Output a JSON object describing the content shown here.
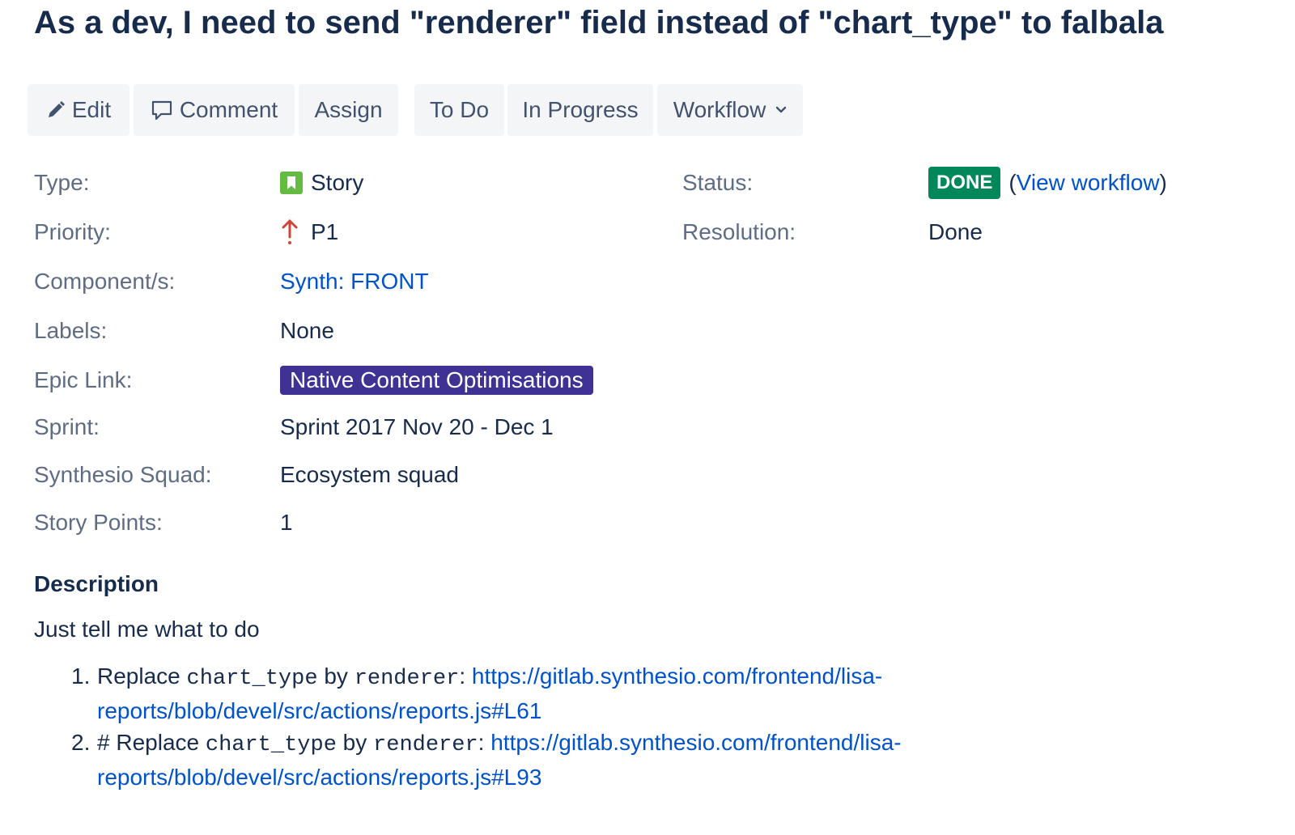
{
  "issue": {
    "title": "As a dev, I need to send \"renderer\" field instead of \"chart_type\" to falbala"
  },
  "toolbar": {
    "edit_label": "Edit",
    "comment_label": "Comment",
    "assign_label": "Assign",
    "todo_label": "To Do",
    "in_progress_label": "In Progress",
    "workflow_label": "Workflow"
  },
  "details": {
    "type_label": "Type:",
    "type_value": "Story",
    "priority_label": "Priority:",
    "priority_value": "P1",
    "components_label": "Component/s:",
    "components_value": "Synth: FRONT",
    "labels_label": "Labels:",
    "labels_value": "None",
    "epic_label": "Epic Link:",
    "epic_value": "Native Content Optimisations",
    "sprint_label": "Sprint:",
    "sprint_value": "Sprint 2017 Nov 20 - Dec 1",
    "squad_label": "Synthesio Squad:",
    "squad_value": "Ecosystem squad",
    "points_label": "Story Points:",
    "points_value": "1",
    "status_label": "Status:",
    "status_value": "DONE",
    "view_workflow_open": "(",
    "view_workflow_label": "View workflow",
    "view_workflow_close": ")",
    "resolution_label": "Resolution:",
    "resolution_value": "Done"
  },
  "description": {
    "heading": "Description",
    "intro": "Just tell me what to do",
    "items": [
      {
        "number": "1.",
        "prefix": "Replace ",
        "code1": "chart_type",
        "middle": " by ",
        "code2": "renderer",
        "colon": ": ",
        "link": "https://gitlab.synthesio.com/frontend/lisa-reports/blob/devel/src/actions/reports.js#L61"
      },
      {
        "number": "2.",
        "prefix": "# Replace ",
        "code1": "chart_type",
        "middle": " by ",
        "code2": "renderer",
        "colon": ": ",
        "link": "https://gitlab.synthesio.com/frontend/lisa-reports/blob/devel/src/actions/reports.js#L93"
      }
    ]
  },
  "colors": {
    "text": "#172b4d",
    "label": "#5e6c84",
    "link": "#0052cc",
    "button_bg": "#f4f5f7",
    "done_badge": "#00875a",
    "epic_badge": "#403294",
    "story_icon": "#65ba43",
    "priority_icon": "#d04437"
  },
  "icons": {
    "edit": "pencil-icon",
    "comment": "speech-bubble-icon",
    "workflow": "chevron-down-icon",
    "type": "story-bookmark-icon",
    "priority": "arrow-up-icon"
  }
}
